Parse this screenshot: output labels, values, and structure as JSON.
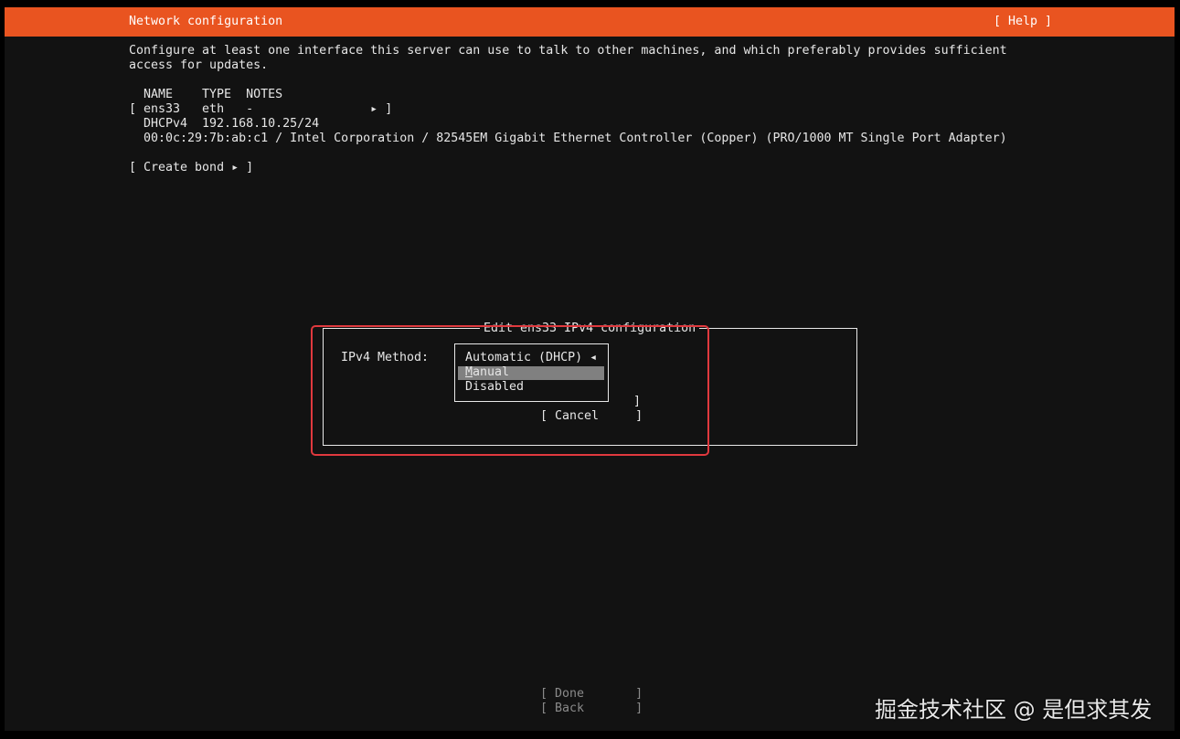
{
  "header": {
    "title": "Network configuration",
    "help": "[ Help ]",
    "color": "#e95420"
  },
  "description": [
    "Configure at least one interface this server can use to talk to other machines, and which preferably provides sufficient",
    "access for updates."
  ],
  "table": {
    "columns": "NAME    TYPE  NOTES",
    "row": "[ ens33   eth   -                ▸ ]",
    "dhcp": "DHCPv4  192.168.10.25/24",
    "hw": "00:0c:29:7b:ab:c1 / Intel Corporation / 82545EM Gigabit Ethernet Controller (Copper) (PRO/1000 MT Single Port Adapter)"
  },
  "create_bond": "[ Create bond ▸ ]",
  "dialog": {
    "title": "Edit ens33 IPv4 configuration",
    "method_label": "IPv4 Method:",
    "options": [
      {
        "label": "Automatic (DHCP) ◂",
        "selected": true
      },
      {
        "first": "M",
        "rest": "anual",
        "highlighted": true
      },
      {
        "label": "Disabled"
      }
    ],
    "bracket": "]",
    "cancel": "[ Cancel     ]"
  },
  "footer": {
    "done": "[ Done       ]",
    "back": "[ Back       ]"
  },
  "watermark": "掘金技术社区 @ 是但求其发"
}
